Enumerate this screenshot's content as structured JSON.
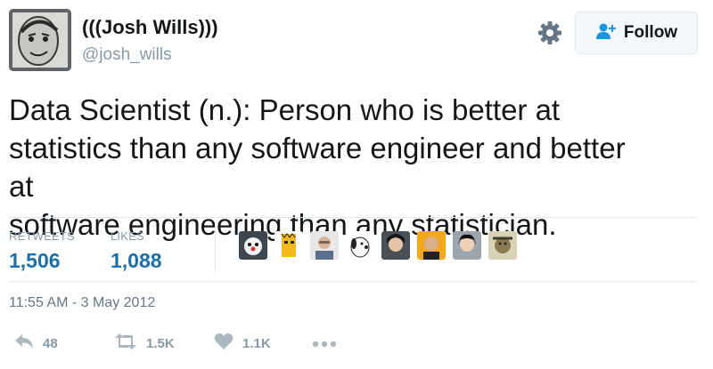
{
  "author": {
    "name": "(((Josh Wills)))",
    "handle": "@josh_wills"
  },
  "follow_button": {
    "label": "Follow",
    "icon": "add-person-icon"
  },
  "settings_icon": "gear-icon",
  "tweet": {
    "lines": [
      "Data Scientist (n.): Person who is better at",
      "statistics than any software engineer and better at",
      "software engineering than any statistician."
    ]
  },
  "stats": {
    "retweets_label": "RETWEETS",
    "retweets": "1,506",
    "likes_label": "LIKES",
    "likes": "1,088"
  },
  "timestamp": "11:55 AM - 3 May 2012",
  "actions": {
    "reply_count": "48",
    "retweet_count": "1.5K",
    "like_count": "1.1K"
  },
  "colors": {
    "link": "#1b6ea8",
    "muted": "#8899a6",
    "border": "#e1e8ed"
  }
}
